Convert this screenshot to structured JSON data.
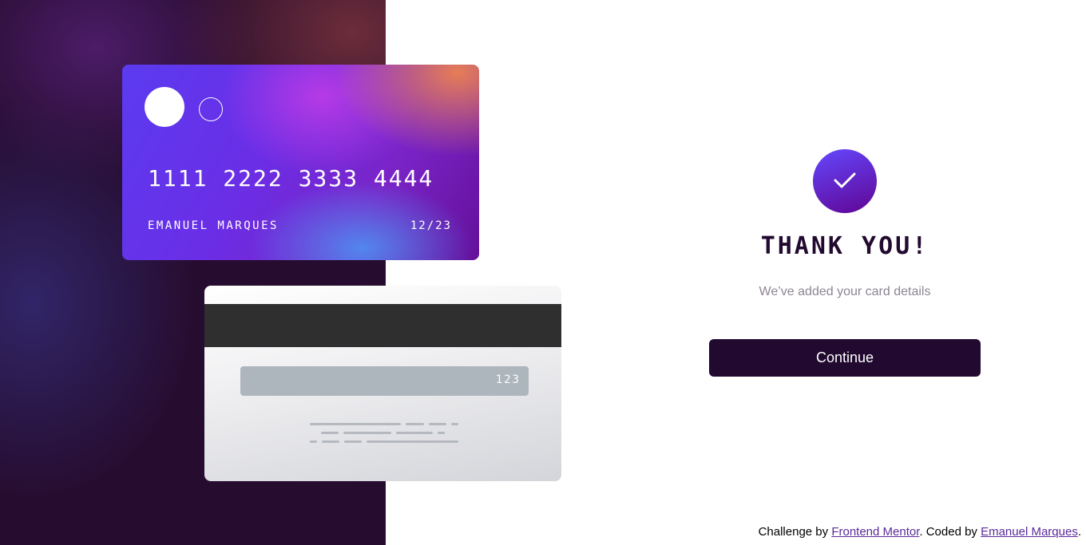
{
  "card_front": {
    "number": "1111 2222 3333 4444",
    "name": "EMANUEL MARQUES",
    "expiry": "12/23"
  },
  "card_back": {
    "cvc": "123"
  },
  "complete": {
    "icon": "check-icon",
    "title": "THANK YOU!",
    "subtitle": "We’ve added your card details",
    "button_label": "Continue"
  },
  "attribution": {
    "prefix": "Challenge by ",
    "challenge_link": "Frontend Mentor",
    "middle": ". Coded by ",
    "author_link": "Emanuel Marques",
    "suffix": "."
  },
  "colors": {
    "dark_violet": "#21092f",
    "grayish_violet": "#8e8593",
    "accent_start": "#6448fe",
    "accent_end": "#600594"
  }
}
